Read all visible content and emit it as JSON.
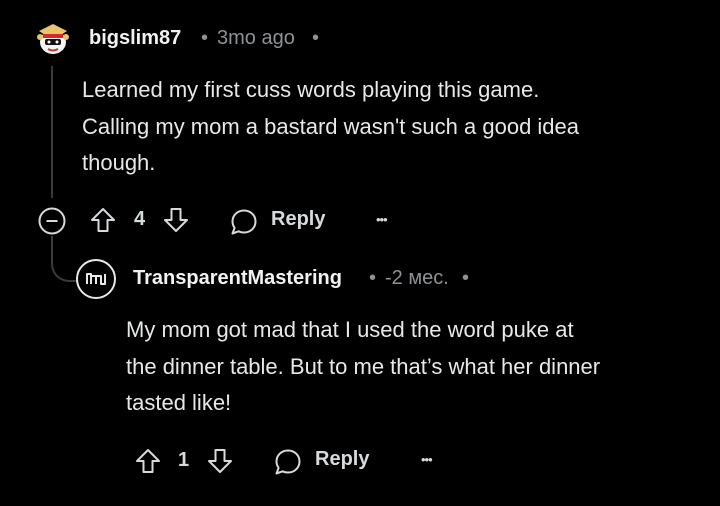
{
  "comments": [
    {
      "username": "bigslim87",
      "separator_left": "•",
      "time": "3mo ago",
      "separator_right": "•",
      "lines": [
        "Learned my first cuss words playing this game.",
        "Calling my mom a bastard wasn't such a good idea",
        "though."
      ],
      "votes": "4",
      "reply_label": "Reply",
      "more_label": "•••"
    },
    {
      "username": "TransparentMastering",
      "separator_left": "•",
      "time": "-2 мес.",
      "separator_right": "•",
      "lines": [
        "My mom got mad that I used the word puke at",
        "the dinner table. But to me that’s what her dinner",
        "tasted like!"
      ],
      "votes": "1",
      "reply_label": "Reply",
      "more_label": "•••"
    }
  ],
  "icons": {
    "collapse": "minus-circle-icon",
    "upvote": "arrow-up-icon",
    "downvote": "arrow-down-icon",
    "reply": "speech-bubble-icon",
    "more": "ellipsis-icon"
  },
  "colors": {
    "background": "#000000",
    "text": "#e6e8ea",
    "meta": "#8e9196",
    "thread_line": "#3a3a3c"
  }
}
